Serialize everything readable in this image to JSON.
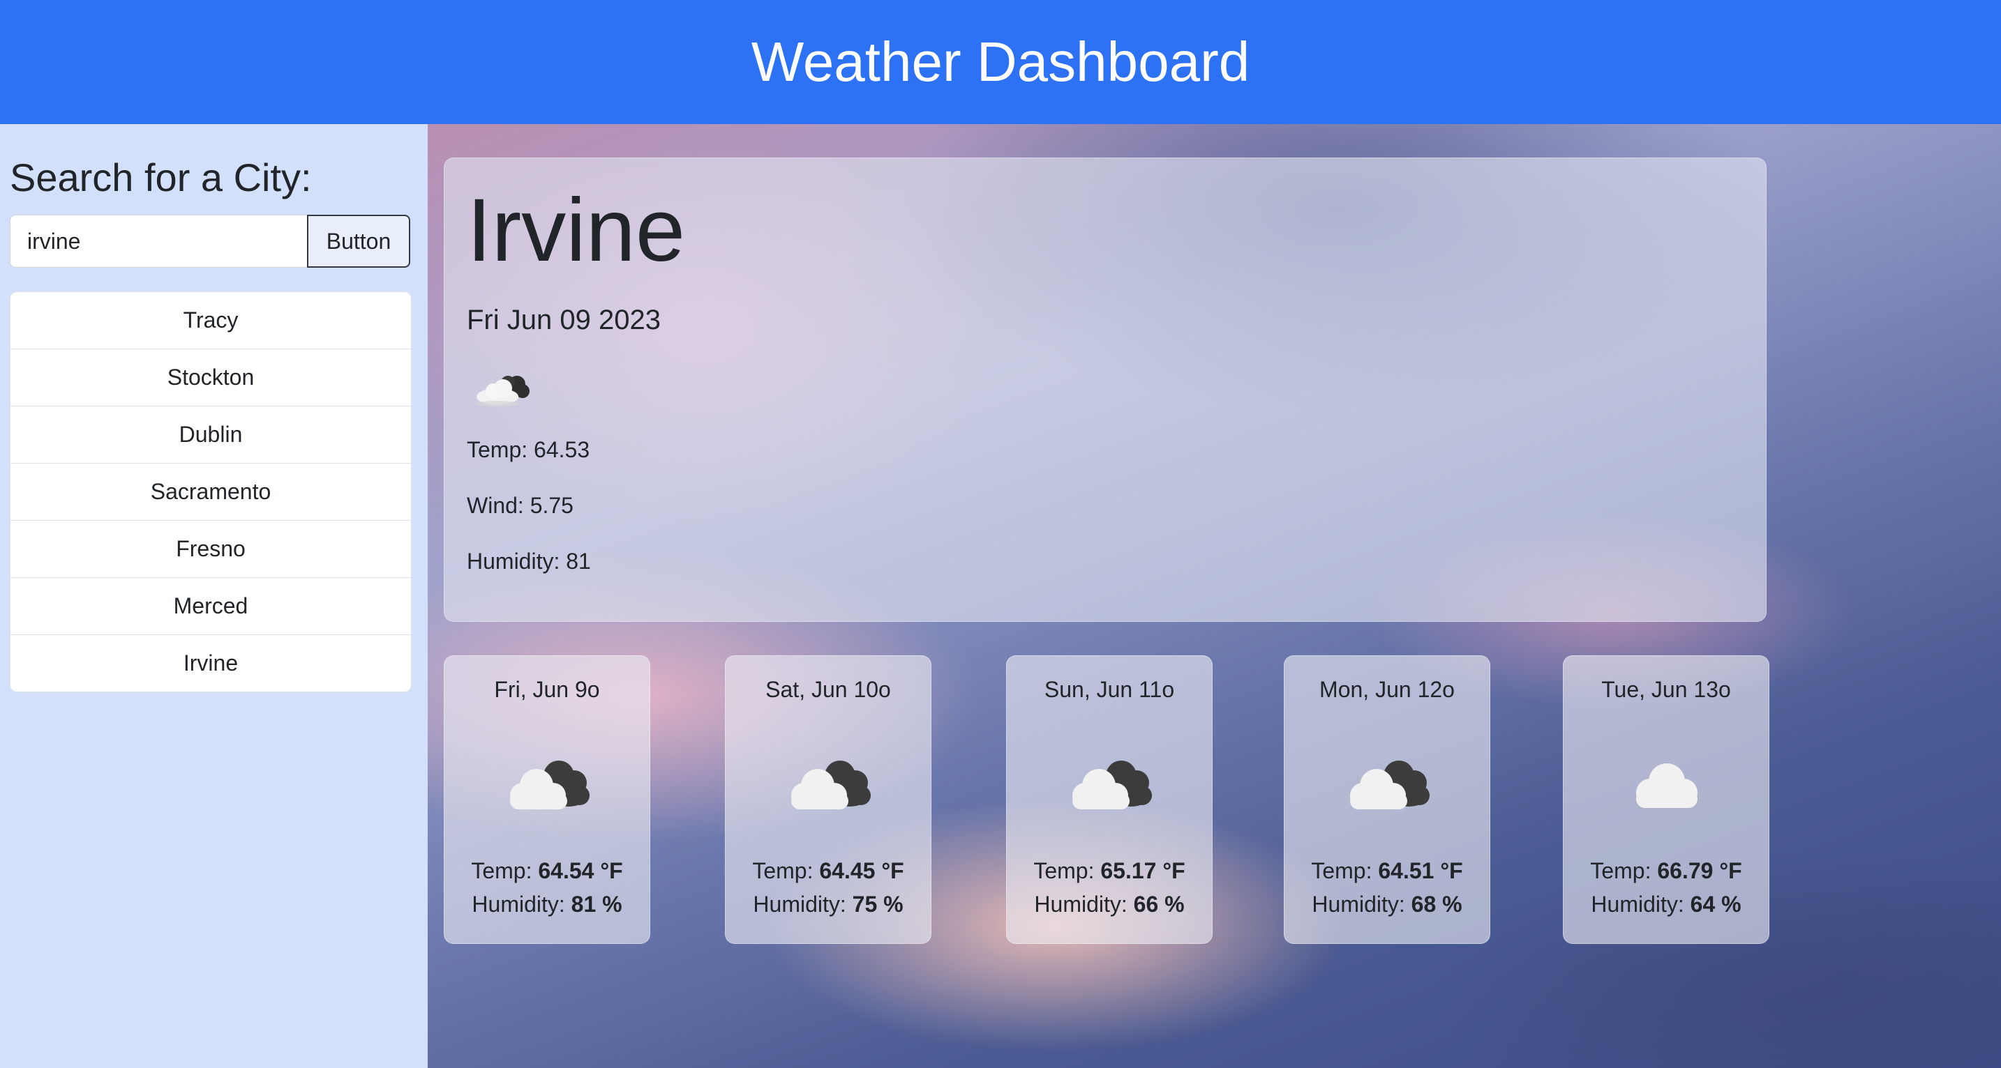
{
  "header": {
    "title": "Weather Dashboard"
  },
  "sidebar": {
    "heading": "Search for a City:",
    "search_value": "irvine",
    "button_label": "Button",
    "history": [
      "Tracy",
      "Stockton",
      "Dublin",
      "Sacramento",
      "Fresno",
      "Merced",
      "Irvine"
    ]
  },
  "current": {
    "city": "Irvine",
    "date": "Fri Jun 09 2023",
    "icon": "partly-cloudy-night-icon",
    "temp": "Temp: 64.53",
    "wind": "Wind: 5.75",
    "humidity": "Humidity: 81"
  },
  "forecast": [
    {
      "date": "Fri, Jun 9o",
      "icon": "broken-clouds-icon",
      "temp_label": "Temp: ",
      "temp": "64.54 °F",
      "humidity_label": "Humidity: ",
      "humidity": "81 %"
    },
    {
      "date": "Sat, Jun 10o",
      "icon": "broken-clouds-icon",
      "temp_label": "Temp: ",
      "temp": "64.45 °F",
      "humidity_label": "Humidity: ",
      "humidity": "75 %"
    },
    {
      "date": "Sun, Jun 11o",
      "icon": "broken-clouds-icon",
      "temp_label": "Temp: ",
      "temp": "65.17 °F",
      "humidity_label": "Humidity: ",
      "humidity": "66 %"
    },
    {
      "date": "Mon, Jun 12o",
      "icon": "broken-clouds-icon",
      "temp_label": "Temp: ",
      "temp": "64.51 °F",
      "humidity_label": "Humidity: ",
      "humidity": "68 %"
    },
    {
      "date": "Tue, Jun 13o",
      "icon": "cloud-icon",
      "temp_label": "Temp: ",
      "temp": "66.79 °F",
      "humidity_label": "Humidity: ",
      "humidity": "64 %"
    }
  ],
  "colors": {
    "header_bg": "#2d72f5",
    "sidebar_bg": "#d3e0fb"
  }
}
